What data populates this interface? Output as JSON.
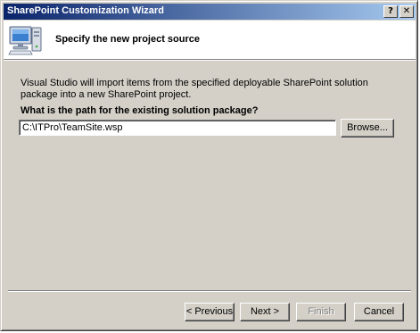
{
  "window": {
    "title": "SharePoint Customization Wizard",
    "help_glyph": "?",
    "close_glyph": "✕"
  },
  "header": {
    "title": "Specify the new project source",
    "icon": "computer-icon"
  },
  "body": {
    "description": "Visual Studio will import items from the specified deployable SharePoint solution package into a new SharePoint project.",
    "question": "What is the path for the existing solution package?",
    "path_value": "C:\\ITPro\\TeamSite.wsp",
    "browse_label": "Browse..."
  },
  "footer": {
    "previous_label": "< Previous",
    "next_label": "Next >",
    "finish_label": "Finish",
    "cancel_label": "Cancel",
    "finish_enabled": false
  },
  "colors": {
    "face": "#d4d0c8",
    "title_start": "#0a246a",
    "title_end": "#a6caf0"
  }
}
